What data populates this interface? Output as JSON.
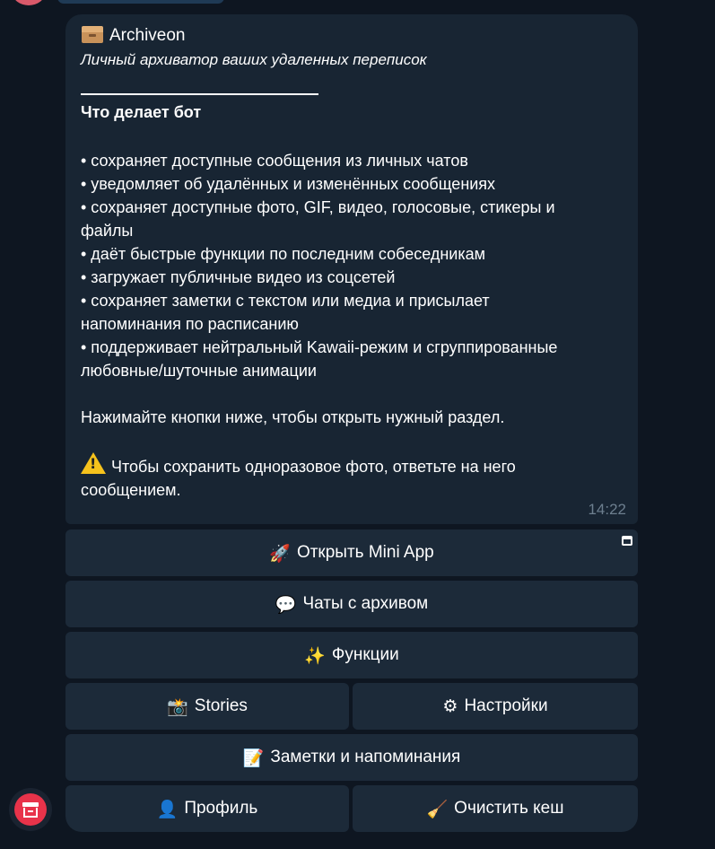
{
  "message": {
    "title": "Archiveon",
    "title_icon": "box-icon",
    "subtitle": "Личный архиватор ваших удаленных переписок",
    "heading": "Что делает бот",
    "bullets": [
      "• сохраняет доступные сообщения из личных чатов",
      "• уведомляет об удалённых и изменённых сообщениях",
      "• сохраняет доступные фото, GIF, видео, голосовые, стикеры и",
      "файлы",
      "• даёт быстрые функции по последним собеседникам",
      "• загружает публичные видео из соцсетей",
      "• сохраняет заметки с текстом или медиа и присылает",
      "напоминания по расписанию",
      "• поддерживает нейтральный Kawaii-режим и сгруппированные",
      "любовные/шуточные анимации"
    ],
    "hint": "Нажимайте кнопки ниже, чтобы открыть нужный раздел.",
    "warning_line1": "Чтобы сохранить одноразовое фото, ответьте на него",
    "warning_line2": "сообщением.",
    "time": "14:22"
  },
  "keyboard": {
    "open_mini_app": {
      "emoji": "🚀",
      "label": "Открыть Mini App"
    },
    "chats_archive": {
      "emoji": "💬",
      "label": "Чаты с архивом"
    },
    "functions": {
      "emoji": "✨",
      "label": "Функции"
    },
    "stories": {
      "emoji": "📸",
      "label": "Stories"
    },
    "settings": {
      "emoji": "⚙",
      "label": "Настройки"
    },
    "notes": {
      "emoji": "📝",
      "label": "Заметки и напоминания"
    },
    "profile": {
      "emoji": "👤",
      "label": "Профиль"
    },
    "clear_cache": {
      "emoji": "🧹",
      "label": "Очистить кеш"
    }
  },
  "colors": {
    "background": "#0e1621",
    "bubble": "#182533",
    "button": "#1c2a39",
    "time": "#6d7f8f",
    "avatar_accent": "#e8334a"
  }
}
